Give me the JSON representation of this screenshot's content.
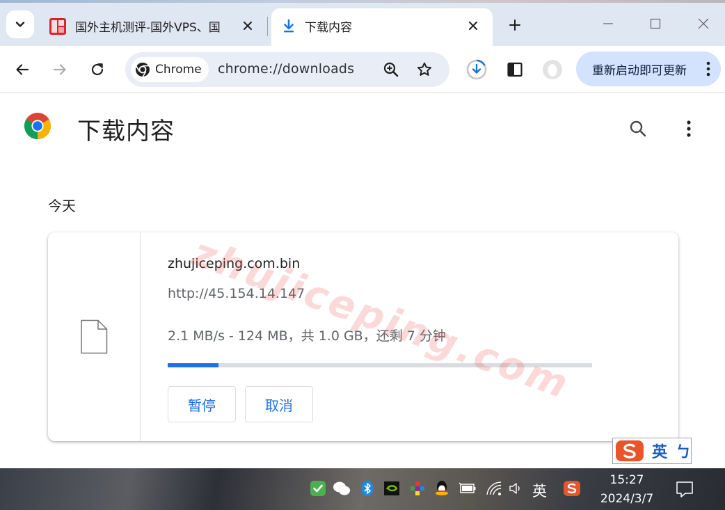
{
  "tabs": {
    "inactive_title": "国外主机测评-国外VPS、国",
    "active_title": "下载内容"
  },
  "toolbar": {
    "chip_label": "Chrome",
    "url": "chrome://downloads",
    "update_label": "重新启动即可更新"
  },
  "page": {
    "title": "下载内容",
    "section_today": "今天"
  },
  "download": {
    "filename": "zhujiceping.com.bin",
    "source_url": "http://45.154.14.147",
    "status": "2.1 MB/s - 124 MB，共 1.0 GB，还剩 7 分钟",
    "progress_fraction": 0.12,
    "pause_label": "暂停",
    "cancel_label": "取消"
  },
  "watermark": "zhujiceping.com",
  "ime": {
    "lang": "英",
    "punct": "ㄅ"
  },
  "taskbar": {
    "ime_lang": "英",
    "time": "15:27",
    "date": "2024/3/7"
  },
  "colors": {
    "accent": "#1a73e8",
    "update_bg": "#d3e3fd",
    "omnibox_bg": "#e9eef6",
    "tabstrip_bg": "#dfe7f3"
  },
  "icons": [
    "tab-search-icon",
    "favicon-icon",
    "download-icon",
    "close-icon",
    "plus-icon",
    "minimize-icon",
    "maximize-icon",
    "window-close-icon",
    "back-icon",
    "forward-icon",
    "reload-icon",
    "chrome-logo-icon",
    "zoom-icon",
    "star-icon",
    "download-status-icon",
    "side-panel-icon",
    "profile-icon",
    "more-vert-icon",
    "search-icon",
    "file-icon",
    "sogou-icon",
    "notification-icon"
  ]
}
